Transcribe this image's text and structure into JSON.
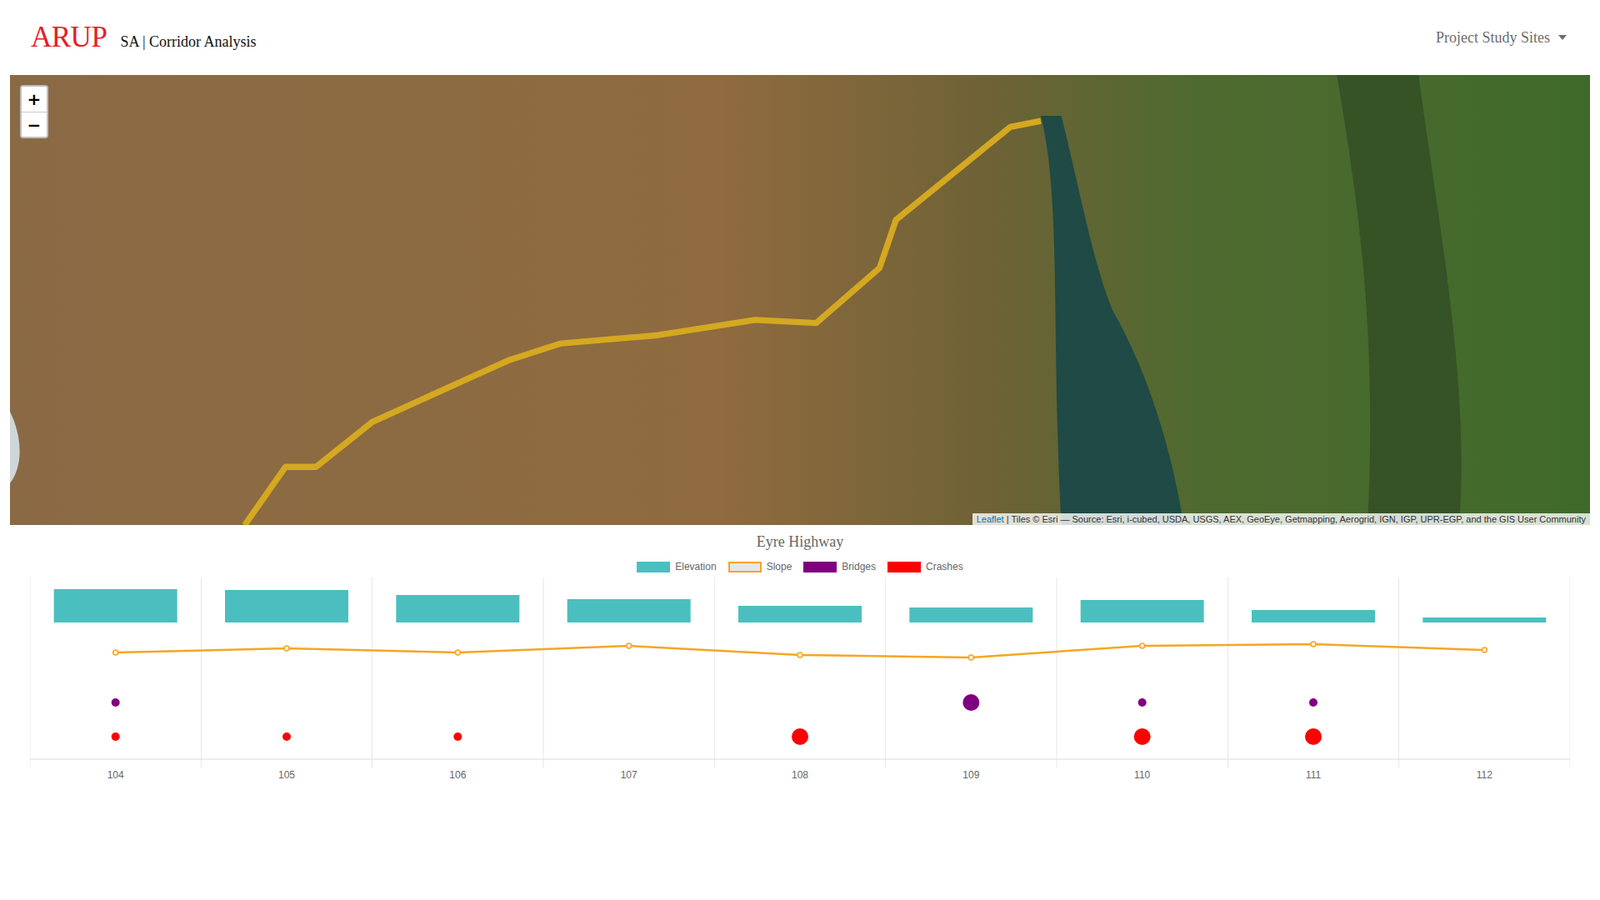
{
  "header": {
    "logo": "ARUP",
    "title": "SA | Corridor Analysis",
    "menu": {
      "label": "Project Study Sites",
      "expanded": false
    }
  },
  "map": {
    "zoom_in": "+",
    "zoom_out": "−",
    "attribution_link": "Leaflet",
    "attribution": " | Tiles © Esri — Source: Esri, i-cubed, USDA, USGS, AEX, GeoEye, Getmapping, Aerogrid, IGN, IGP, UPR-EGP, and the GIS User Community"
  },
  "chart": {
    "title": "Eyre Highway",
    "legend": [
      {
        "label": "Elevation",
        "color": "#4bbfbf",
        "kind": "fill"
      },
      {
        "label": "Slope",
        "color": "#f5a623",
        "kind": "outline"
      },
      {
        "label": "Bridges",
        "color": "#800080",
        "kind": "fill"
      },
      {
        "label": "Crashes",
        "color": "#ff0000",
        "kind": "fill"
      }
    ],
    "x_labels": [
      "104",
      "105",
      "106",
      "107",
      "108",
      "109",
      "110",
      "111",
      "112"
    ],
    "elevation": [
      160,
      156,
      132,
      112,
      80,
      72,
      108,
      60,
      24
    ],
    "slope": [
      1.0,
      1.5,
      1.0,
      1.8,
      0.7,
      0.4,
      1.8,
      2.0,
      1.3
    ],
    "bridges": [
      1,
      0,
      0,
      0,
      0,
      3,
      1,
      1,
      0
    ],
    "crashes": [
      1,
      1,
      1,
      0,
      3,
      0,
      3,
      3,
      0
    ]
  }
}
